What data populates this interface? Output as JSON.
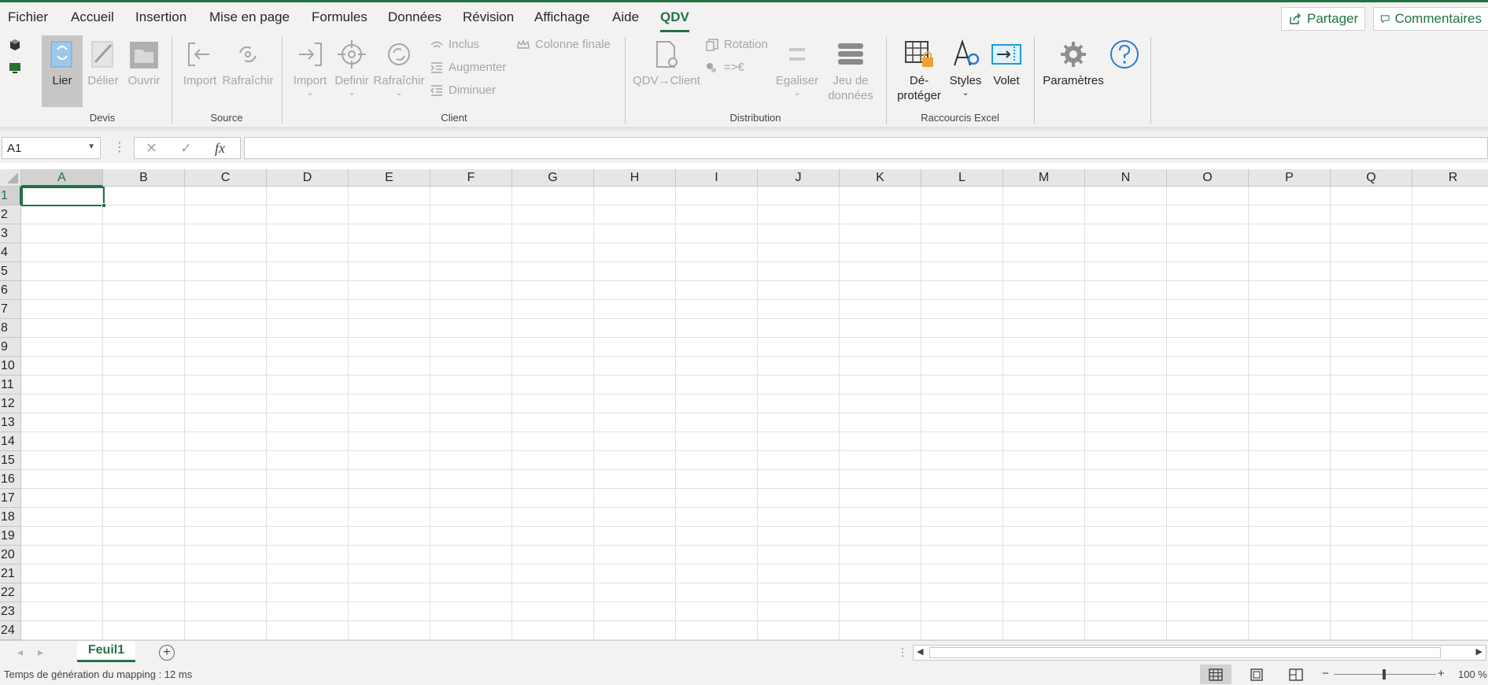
{
  "menu": {
    "items": [
      "Fichier",
      "Accueil",
      "Insertion",
      "Mise en page",
      "Formules",
      "Données",
      "Révision",
      "Affichage",
      "Aide",
      "QDV"
    ],
    "active": "QDV",
    "share_label": "Partager",
    "comments_label": "Commentaires"
  },
  "ribbon": {
    "devis": {
      "label": "Devis",
      "lier": "Lier",
      "delier": "Délier",
      "ouvrir": "Ouvrir"
    },
    "source": {
      "label": "Source",
      "import": "Import",
      "rafraichir": "Rafraîchir"
    },
    "client": {
      "label": "Client",
      "import": "Import",
      "definir": "Definir",
      "rafraichir": "Rafraîchir",
      "inclus": "Inclus",
      "augmenter": "Augmenter",
      "diminuer": "Diminuer",
      "colonne_finale": "Colonne finale"
    },
    "distribution": {
      "label": "Distribution",
      "qdv_client": "QDV→Client",
      "rotation": "Rotation",
      "euro": "=>€",
      "egaliser": "Egaliser",
      "jeu_line1": "Jeu de",
      "jeu_line2": "données"
    },
    "raccourcis": {
      "label": "Raccourcis Excel",
      "deproteger_line1": "Dé-",
      "deproteger_line2": "protéger",
      "styles": "Styles",
      "volet": "Volet"
    },
    "parametres": "Paramètres"
  },
  "formula_bar": {
    "name_box": "A1",
    "fx": "fx",
    "value": ""
  },
  "grid": {
    "columns": [
      "A",
      "B",
      "C",
      "D",
      "E",
      "F",
      "G",
      "H",
      "I",
      "J",
      "K",
      "L",
      "M",
      "N",
      "O",
      "P",
      "Q",
      "R"
    ],
    "rows": [
      "1",
      "2",
      "3",
      "4",
      "5",
      "6",
      "7",
      "8",
      "9",
      "10",
      "11",
      "12",
      "13",
      "14",
      "15",
      "16",
      "17",
      "18",
      "19",
      "20",
      "21",
      "22",
      "23",
      "24"
    ],
    "active_cell": "A1"
  },
  "sheets": {
    "tabs": [
      "Feuil1"
    ],
    "active": "Feuil1"
  },
  "status": {
    "message": "Temps de génération du mapping : 12 ms",
    "zoom": "100 %"
  },
  "colors": {
    "accent": "#217346",
    "ribbon_bg": "#f3f2f1",
    "disabled": "#a6a6a6"
  }
}
